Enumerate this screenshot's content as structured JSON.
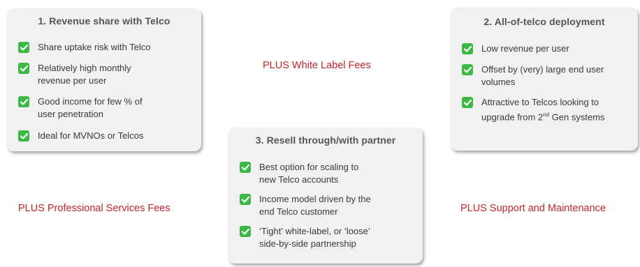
{
  "cards": [
    {
      "title": "1. Revenue share with Telco",
      "items": [
        [
          "Share uptake risk with Telco"
        ],
        [
          "Relatively high monthly",
          "revenue per user"
        ],
        [
          "Good income for few % of",
          "user penetration"
        ],
        [
          "Ideal for MVNOs or Telcos"
        ]
      ]
    },
    {
      "title": "2. All-of-telco deployment",
      "items": [
        [
          "Low revenue per user"
        ],
        [
          "Offset by (very) large end user",
          "volumes"
        ],
        [
          "Attractive to Telcos looking to",
          "upgrade from 2",
          "nd",
          " Gen systems"
        ]
      ]
    },
    {
      "title": "3. Resell through/with partner",
      "items": [
        [
          "Best option for scaling to",
          "new Telco accounts"
        ],
        [
          "Income model driven by the",
          "end Telco customer"
        ],
        [
          "‘Tight’ white-label, or ‘loose’",
          "side-by-side partnership"
        ]
      ]
    }
  ],
  "plus_labels": {
    "white_label": "PLUS White Label Fees",
    "professional": "PLUS Professional Services Fees",
    "support": "PLUS Support and Maintenance"
  },
  "icons": {
    "check": "checkmark-icon",
    "check_color": "#3db847",
    "plus_color": "#c0292f"
  }
}
